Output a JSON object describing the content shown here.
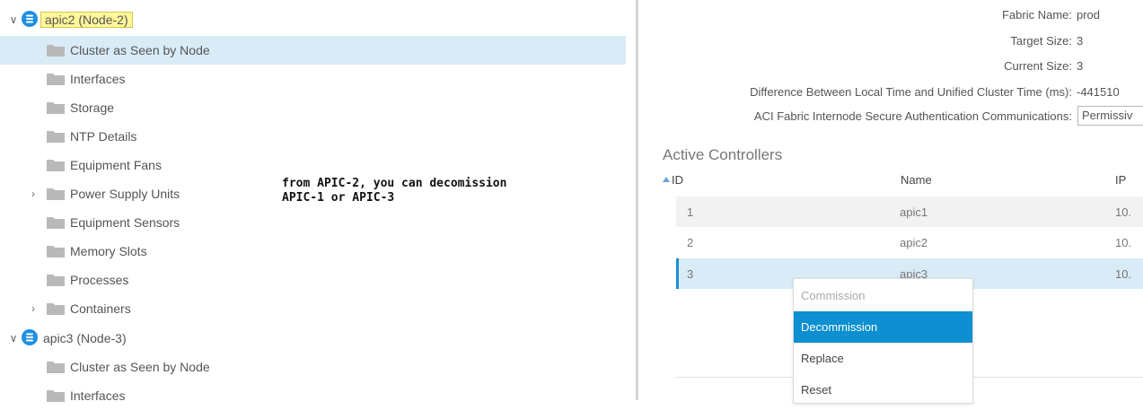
{
  "tree": {
    "items": [
      {
        "label": "apic2 (Node-2)",
        "type": "node",
        "highlighted": true
      },
      {
        "label": "Cluster as Seen by Node",
        "type": "folder",
        "selected": true
      },
      {
        "label": "Interfaces",
        "type": "folder"
      },
      {
        "label": "Storage",
        "type": "folder"
      },
      {
        "label": "NTP Details",
        "type": "folder"
      },
      {
        "label": "Equipment Fans",
        "type": "folder"
      },
      {
        "label": "Power Supply Units",
        "type": "folder",
        "expandable": true
      },
      {
        "label": "Equipment Sensors",
        "type": "folder"
      },
      {
        "label": "Memory Slots",
        "type": "folder"
      },
      {
        "label": "Processes",
        "type": "folder"
      },
      {
        "label": "Containers",
        "type": "folder",
        "expandable": true
      },
      {
        "label": "apic3 (Node-3)",
        "type": "node"
      },
      {
        "label": "Cluster as Seen by Node",
        "type": "folder"
      },
      {
        "label": "Interfaces",
        "type": "folder"
      }
    ]
  },
  "annotation": {
    "line1": "from APIC-2, you can decomission",
    "line2": "APIC-1 or APIC-3"
  },
  "properties": {
    "fabric_name_label": "Fabric Name:",
    "fabric_name_value": "prod",
    "target_size_label": "Target Size:",
    "target_size_value": "3",
    "current_size_label": "Current Size:",
    "current_size_value": "3",
    "time_diff_label": "Difference Between Local Time and Unified Cluster Time (ms):",
    "time_diff_value": "-441510",
    "auth_label": "ACI Fabric Internode Secure Authentication Communications:",
    "auth_value": "Permissiv"
  },
  "controllers": {
    "title": "Active Controllers",
    "columns": [
      "ID",
      "Name",
      "IP"
    ],
    "rows": [
      {
        "id": "1",
        "name": "apic1",
        "ip": "10."
      },
      {
        "id": "2",
        "name": "apic2",
        "ip": "10."
      },
      {
        "id": "3",
        "name": "apic3",
        "ip": "10."
      }
    ]
  },
  "context_menu": {
    "items": [
      "Commission",
      "Decommission",
      "Replace",
      "Reset"
    ]
  },
  "colors": {
    "selection": "#d9ebf6",
    "accent": "#0d8fd1",
    "node_icon": "#1f8fe0",
    "highlight": "#fff79a"
  }
}
